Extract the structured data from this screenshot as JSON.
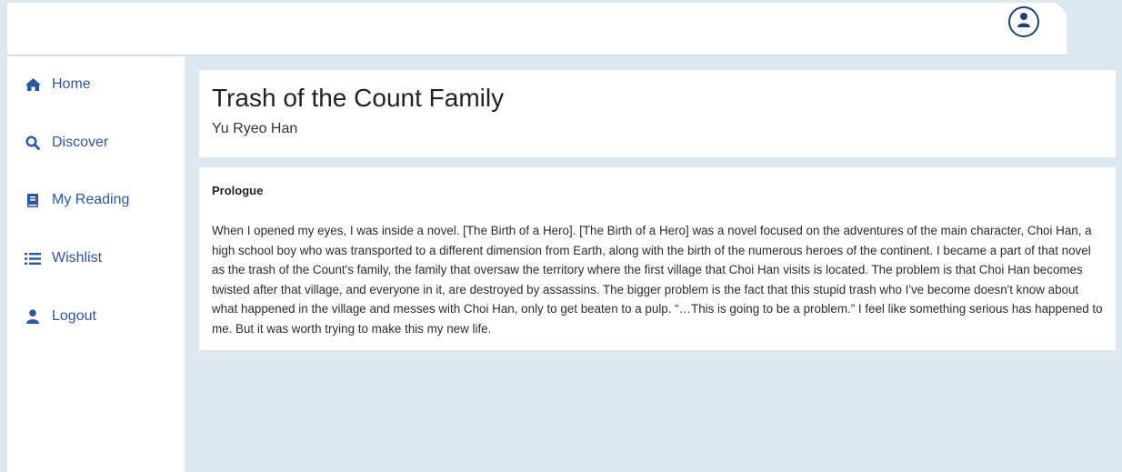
{
  "nav": {
    "items": [
      {
        "label": "Home",
        "icon": "home-icon"
      },
      {
        "label": "Discover",
        "icon": "search-icon"
      },
      {
        "label": "My Reading",
        "icon": "book-icon"
      },
      {
        "label": "Wishlist",
        "icon": "list-icon"
      },
      {
        "label": "Logout",
        "icon": "user-icon"
      }
    ]
  },
  "header": {
    "avatar_icon": "user-circle-icon"
  },
  "book": {
    "title": "Trash of the Count Family",
    "author": "Yu Ryeo Han"
  },
  "chapter": {
    "title": "Prologue",
    "body": "When I opened my eyes, I was inside a novel. [The Birth of a Hero]. [The Birth of a Hero] was a novel focused on the adventures of the main character, Choi Han, a high school boy who was transported to a different dimension from Earth, along with the birth of the numerous heroes of the continent. I became a part of that novel as the trash of the Count's family, the family that oversaw the territory where the first village that Choi Han visits is located. The problem is that Choi Han becomes twisted after that village, and everyone in it, are destroyed by assassins. The bigger problem is the fact that this stupid trash who I've become doesn't know about what happened in the village and messes with Choi Han, only to get beaten to a pulp. “…This is going to be a problem.” I feel like something serious has happened to me. But it was worth trying to make this my new life."
  },
  "colors": {
    "accent": "#2a57a0",
    "background": "#dde8ef",
    "icon_dark": "#1f3f77"
  }
}
